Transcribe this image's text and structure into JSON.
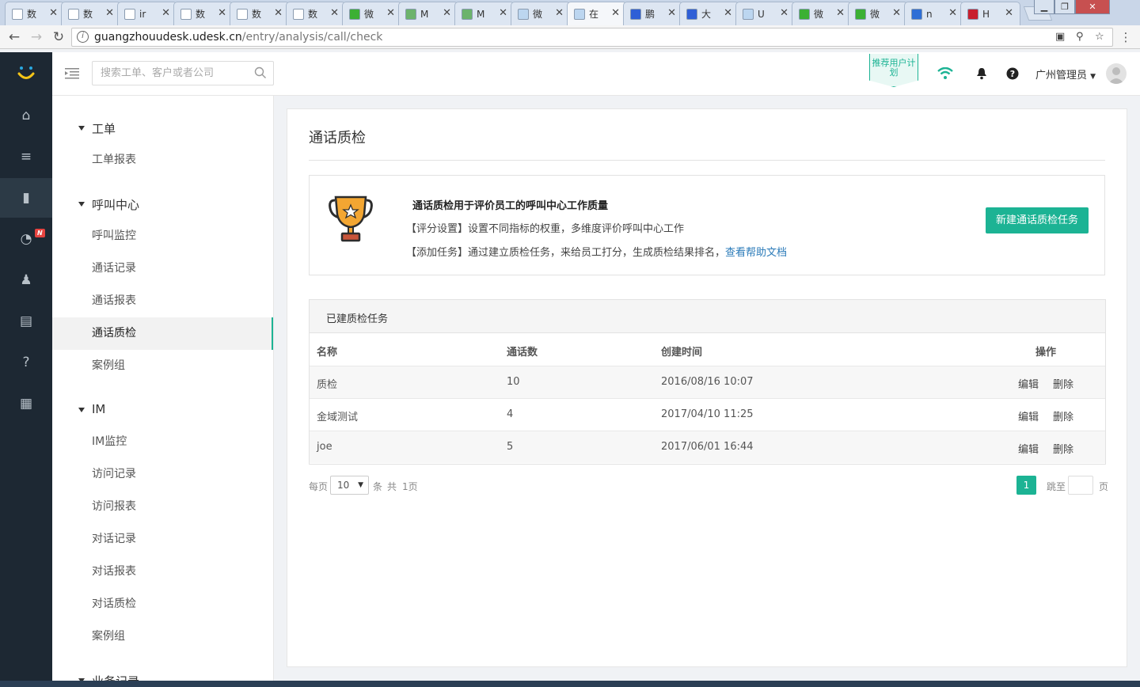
{
  "browser": {
    "tabs": [
      {
        "label": "数",
        "icon": "doc-icon",
        "color": "#ffffff"
      },
      {
        "label": "数",
        "icon": "doc-icon",
        "color": "#ffffff"
      },
      {
        "label": "ir",
        "icon": "doc-icon",
        "color": "#ffffff"
      },
      {
        "label": "数",
        "icon": "doc-icon",
        "color": "#ffffff"
      },
      {
        "label": "数",
        "icon": "doc-icon",
        "color": "#ffffff"
      },
      {
        "label": "数",
        "icon": "doc-icon",
        "color": "#ffffff"
      },
      {
        "label": "微",
        "icon": "wechat-icon",
        "color": "#3cb034"
      },
      {
        "label": "M",
        "icon": "app-icon",
        "color": "#6cb36c"
      },
      {
        "label": "M",
        "icon": "app-icon",
        "color": "#6cb36c"
      },
      {
        "label": "微",
        "icon": "udesk-icon",
        "color": "#bcd6f0"
      },
      {
        "label": "在",
        "icon": "udesk-icon",
        "color": "#bcd6f0"
      },
      {
        "label": "鹏",
        "icon": "baidu-icon",
        "color": "#2f5fd6"
      },
      {
        "label": "大",
        "icon": "baidu-icon",
        "color": "#2f5fd6"
      },
      {
        "label": "U",
        "icon": "udesk-icon",
        "color": "#bcd6f0"
      },
      {
        "label": "微",
        "icon": "wechat-icon",
        "color": "#3cb034"
      },
      {
        "label": "微",
        "icon": "wechat-icon",
        "color": "#3cb034"
      },
      {
        "label": "n",
        "icon": "globe-icon",
        "color": "#2f6fd6"
      },
      {
        "label": "H",
        "icon": "c-icon",
        "color": "#c8202f"
      }
    ],
    "active_tab_index": 10,
    "tab_close": "✕",
    "url_host": "guangzhouudesk.udesk.cn",
    "url_path": "/entry/analysis/call/check",
    "info_glyph": "i"
  },
  "header": {
    "search_placeholder": "搜索工单、客户或者公司",
    "recommend_text": "推荐用户计划",
    "user_name": "广州管理员"
  },
  "appnav": {
    "items": [
      {
        "name": "home-icon",
        "glyph": "⌂"
      },
      {
        "name": "list-icon",
        "glyph": "≡"
      },
      {
        "name": "chart-icon",
        "glyph": "▮"
      },
      {
        "name": "pie-icon",
        "glyph": "◔"
      },
      {
        "name": "users-icon",
        "glyph": "♟"
      },
      {
        "name": "book-icon",
        "glyph": "▤"
      },
      {
        "name": "help-icon",
        "glyph": "?"
      },
      {
        "name": "apps-icon",
        "glyph": "▦"
      }
    ],
    "active_index": 2,
    "new_badge": "N"
  },
  "subnav": {
    "groups": [
      {
        "title": "工单",
        "items": [
          "工单报表"
        ]
      },
      {
        "title": "呼叫中心",
        "items": [
          "呼叫监控",
          "通话记录",
          "通话报表",
          "通话质检",
          "案例组"
        ]
      },
      {
        "title": "IM",
        "items": [
          "IM监控",
          "访问记录",
          "访问报表",
          "对话记录",
          "对话报表",
          "对话质检",
          "案例组"
        ]
      },
      {
        "title": "业务记录",
        "items": []
      }
    ],
    "active_item": "通话质检"
  },
  "main": {
    "title": "通话质检",
    "intro": {
      "heading": "通话质检用于评价员工的呼叫中心工作质量",
      "line1": "【评分设置】设置不同指标的权重，多维度评价呼叫中心工作",
      "line2": "【添加任务】通过建立质检任务，来给员工打分，生成质检结果排名，",
      "help_link": "查看帮助文档",
      "button": "新建通话质检任务"
    },
    "tasks": {
      "panel_title": "已建质检任务",
      "columns": [
        "名称",
        "通话数",
        "创建时间",
        "操作"
      ],
      "rows": [
        {
          "name": "质检",
          "count": "10",
          "created": "2016/08/16 10:07"
        },
        {
          "name": "金域测试",
          "count": "4",
          "created": "2017/04/10 11:25"
        },
        {
          "name": "joe",
          "count": "5",
          "created": "2017/06/01 16:44"
        }
      ],
      "edit_label": "编辑",
      "delete_label": "删除"
    },
    "pagination": {
      "per_page_label": "每页",
      "per_page_value": "10",
      "items_label": "条",
      "total_prefix": "共",
      "total_pages": "1页",
      "current_page": "1",
      "jump_label": "跳至",
      "page_suffix": "页"
    }
  },
  "colors": {
    "accent": "#1cb394",
    "nav_bg": "#1d2833",
    "link": "#2a7ab8"
  }
}
